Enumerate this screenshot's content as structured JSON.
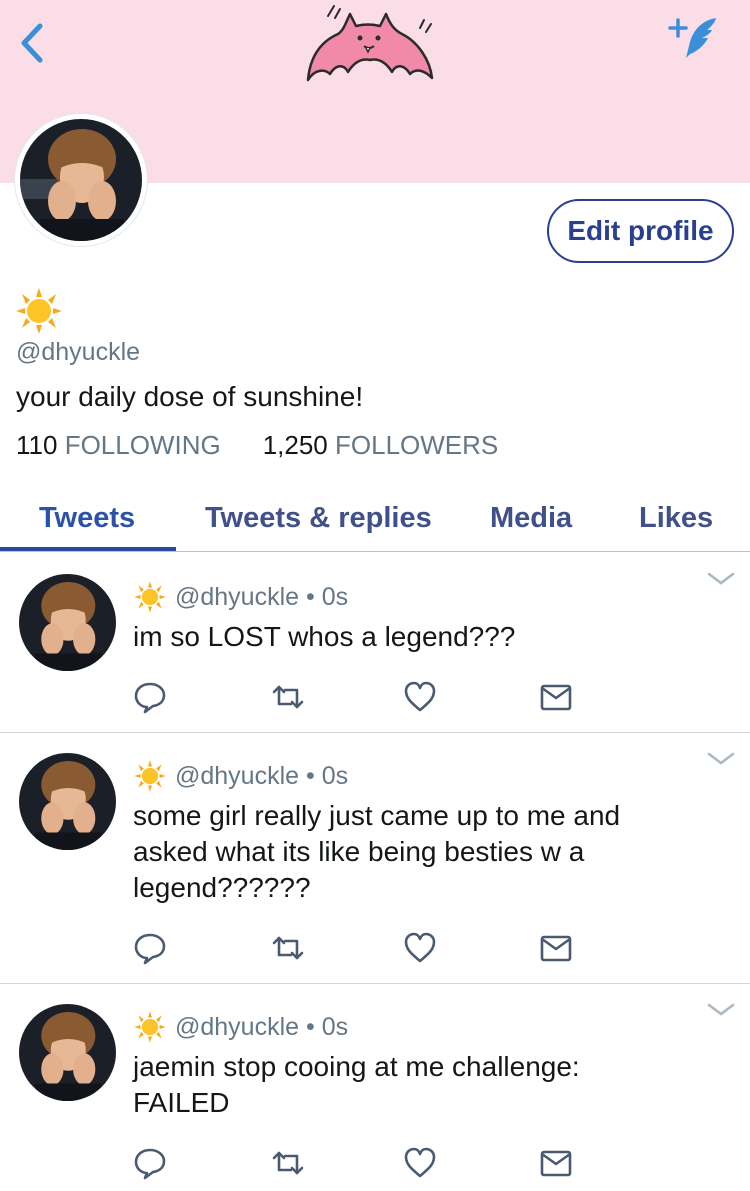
{
  "header": {
    "back_icon": "chevron-left-icon",
    "banner_icon": "bat-doodle-icon",
    "compose_icon": "feather-plus-icon",
    "banner_color": "#fadde6",
    "accent_color": "#3a8fd8"
  },
  "profile": {
    "name_emoji": "sun-emoji-icon",
    "handle": "@dhyuckle",
    "bio": "your daily dose of sunshine!",
    "edit_label": "Edit profile",
    "following_count": "110",
    "following_label": "FOLLOWING",
    "followers_count": "1,250",
    "followers_label": "FOLLOWERS"
  },
  "tabs": [
    {
      "label": "Tweets",
      "active": true
    },
    {
      "label": "Tweets & replies",
      "active": false
    },
    {
      "label": "Media",
      "active": false
    },
    {
      "label": "Likes",
      "active": false
    }
  ],
  "tweets": [
    {
      "handle": "@dhyuckle",
      "dot": "•",
      "time": "0s",
      "text_lines": [
        "im so LOST whos a legend???"
      ]
    },
    {
      "handle": "@dhyuckle",
      "dot": "•",
      "time": "0s",
      "text_lines": [
        "some girl really just came up to me and",
        "asked what its like being besties w a",
        "legend??????"
      ]
    },
    {
      "handle": "@dhyuckle",
      "dot": "•",
      "time": "0s",
      "text_lines": [
        "jaemin stop cooing at me challenge:",
        "FAILED"
      ]
    }
  ],
  "tweet_actions": [
    "reply-icon",
    "retweet-icon",
    "like-heart-icon",
    "message-envelope-icon"
  ]
}
